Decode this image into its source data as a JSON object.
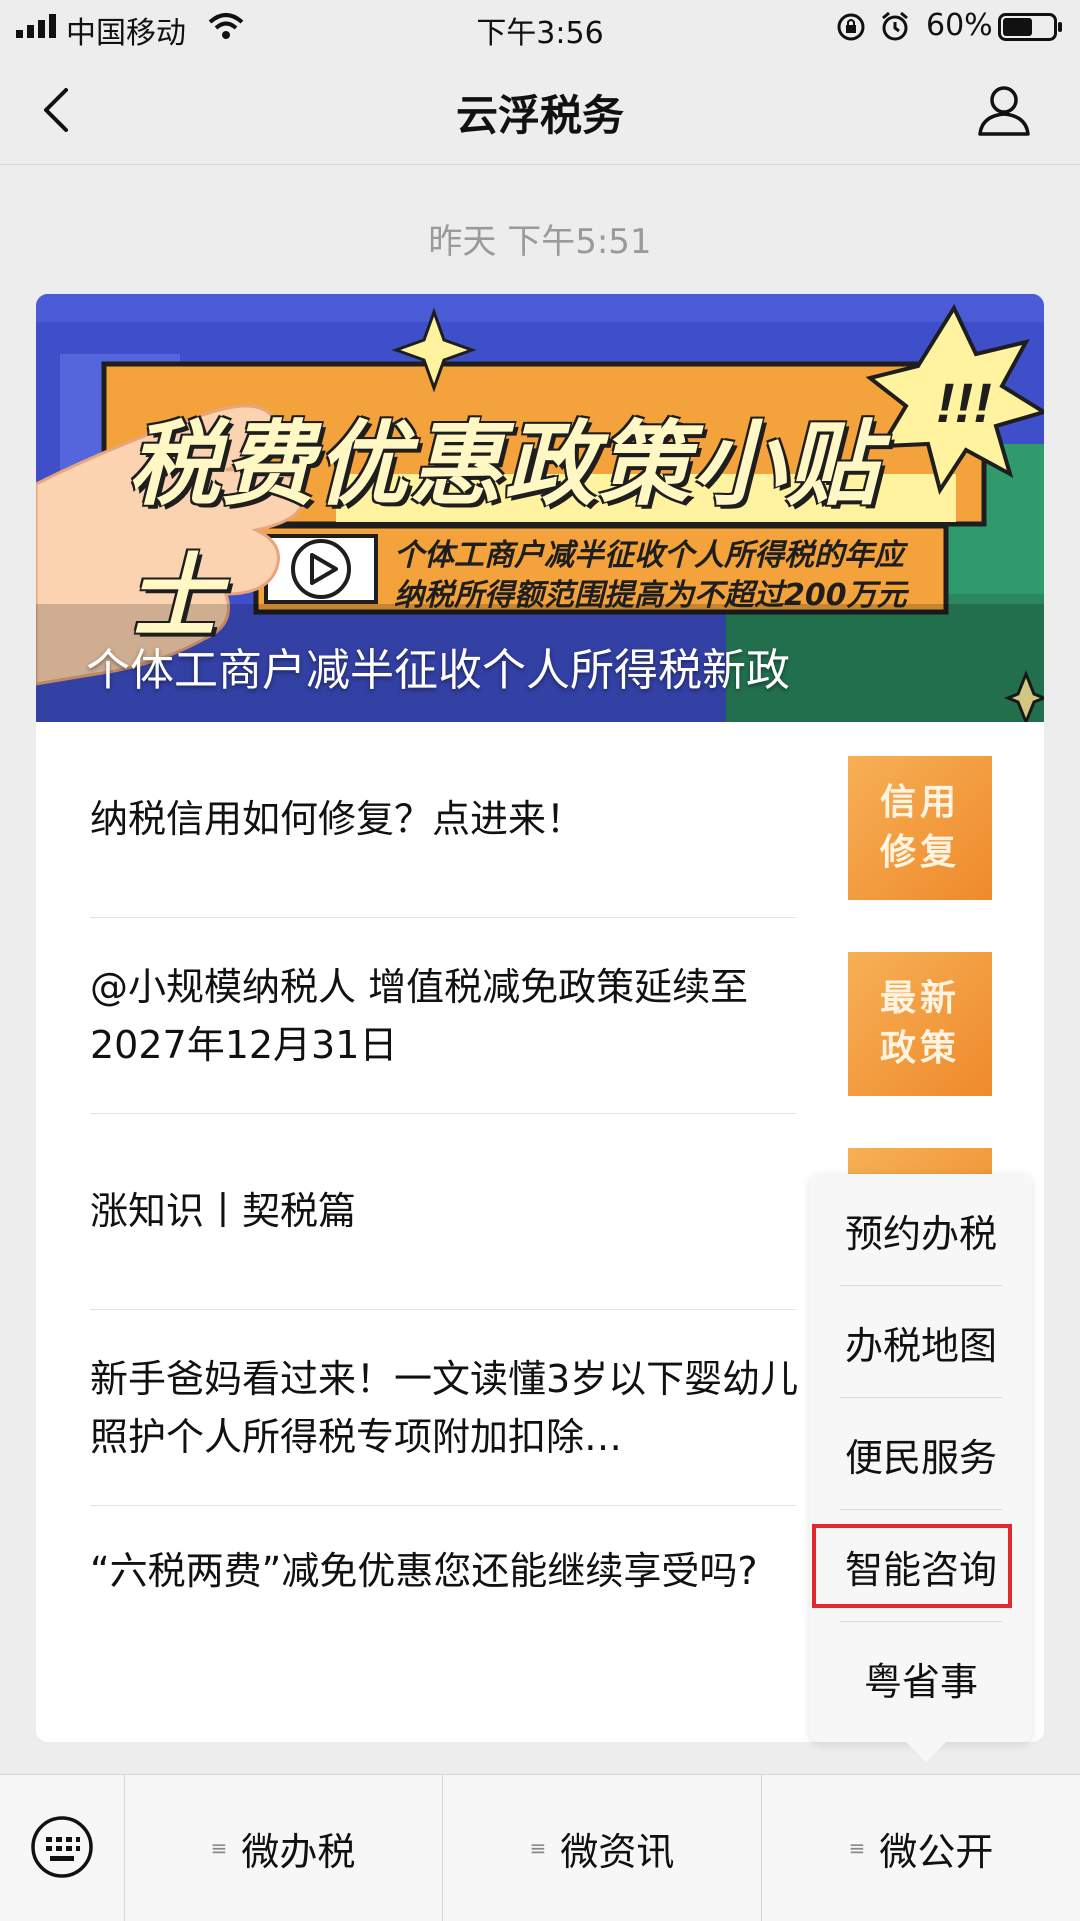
{
  "status_bar": {
    "carrier": "中国移动",
    "time": "下午3:56",
    "battery_percent": "60%",
    "battery_level": 0.6
  },
  "nav": {
    "title": "云浮税务",
    "back_icon": "chevron-left-icon",
    "profile_icon": "person-icon"
  },
  "timestamp": "昨天 下午5:51",
  "banner": {
    "heading": "税费优惠政策小贴士",
    "subline1": "个体工商户减半征收个人所得税的年应",
    "subline2": "纳税所得额范围提高为不超过200万元",
    "title": "个体工商户减半征收个人所得税新政"
  },
  "articles": [
    {
      "text": "纳税信用如何修复？点进来！",
      "thumb": [
        "信用",
        "修复"
      ]
    },
    {
      "text": "@小规模纳税人 增值税减免政策延续至2027年12月31日",
      "thumb": [
        "最新",
        "政策"
      ]
    },
    {
      "text": "涨知识丨契税篇"
    },
    {
      "text": "新手爸妈看过来！一文读懂3岁以下婴幼儿照护个人所得税专项附加扣除…"
    },
    {
      "text": "“六税两费”减免优惠您还能继续享受吗?"
    }
  ],
  "popup_menu": {
    "items": [
      "预约办税",
      "办税地图",
      "便民服务",
      "智能咨询",
      "粤省事"
    ],
    "highlighted": "智能咨询"
  },
  "bottom_bar": {
    "keyboard_icon": "keyboard-icon",
    "tabs": [
      "微办税",
      "微资讯",
      "微公开"
    ]
  },
  "colors": {
    "banner_blue": "#3f4fc9",
    "banner_orange": "#f4a23b",
    "thumb_orange": "#f2993a",
    "highlight_red": "#e0282e"
  }
}
